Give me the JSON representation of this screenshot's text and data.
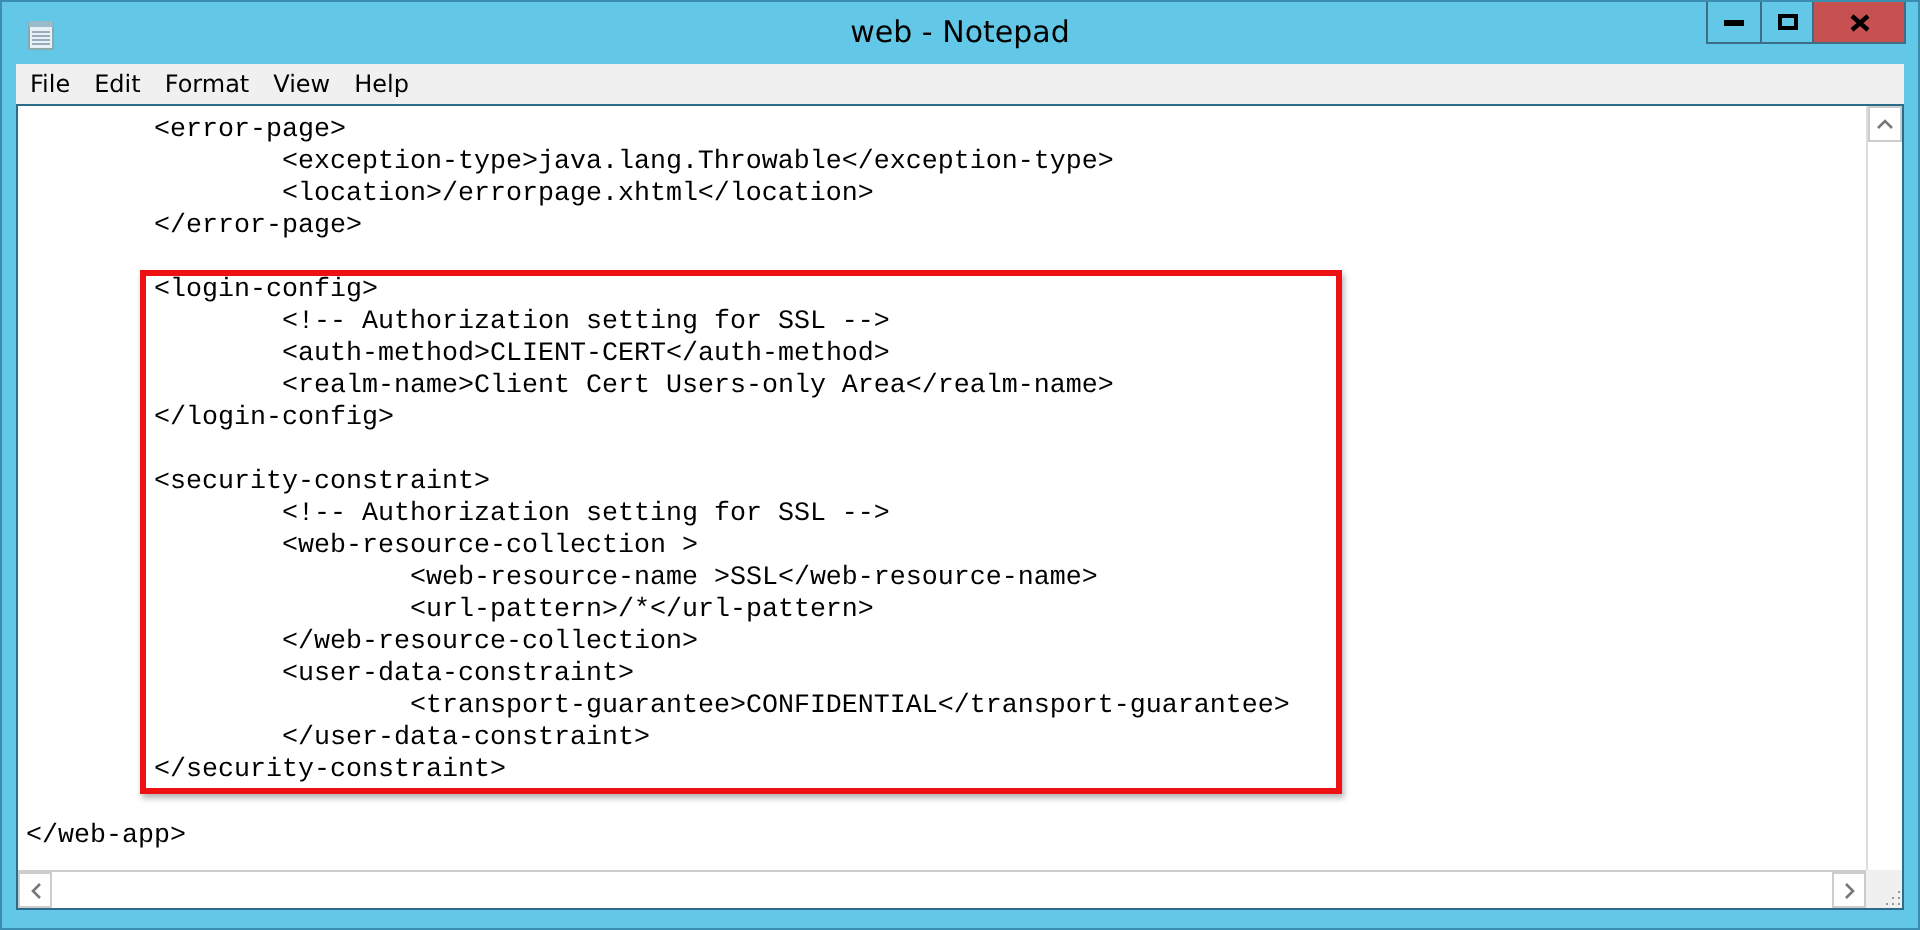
{
  "window": {
    "title": "web - Notepad"
  },
  "menu": [
    "File",
    "Edit",
    "Format",
    "View",
    "Help"
  ],
  "sections": [
    {
      "highlighted": false,
      "paragraphs": [
        [
          "\t<error-page>",
          "\t\t<exception-type>java.lang.Throwable</exception-type>",
          "\t\t<location>/errorpage.xhtml</location>",
          "\t</error-page>"
        ]
      ]
    },
    {
      "highlighted": true,
      "paragraphs": [
        [
          "<login-config>",
          "\t<!-- Authorization setting for SSL -->",
          "\t<auth-method>CLIENT-CERT</auth-method>",
          "\t<realm-name>Client Cert Users-only Area</realm-name>",
          "</login-config>"
        ],
        [
          "<security-constraint>",
          "\t<!-- Authorization setting for SSL -->",
          "\t<web-resource-collection >",
          "\t\t<web-resource-name >SSL</web-resource-name>",
          "\t\t<url-pattern>/*</url-pattern>",
          "\t</web-resource-collection>",
          "\t<user-data-constraint>",
          "\t\t<transport-guarantee>CONFIDENTIAL</transport-guarantee>",
          "\t</user-data-constraint>",
          "</security-constraint>"
        ]
      ]
    },
    {
      "highlighted": false,
      "paragraphs": [
        [
          "</web-app>"
        ]
      ]
    }
  ]
}
